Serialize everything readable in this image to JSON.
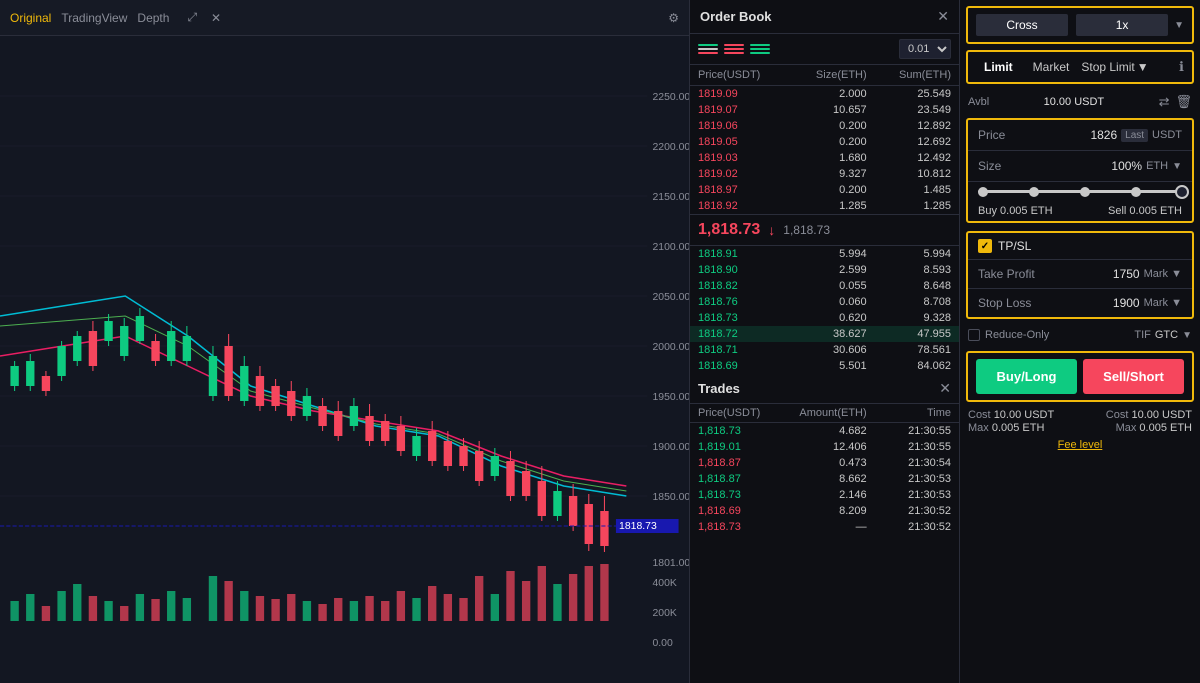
{
  "chart": {
    "tabs": [
      {
        "label": "Original",
        "active": true
      },
      {
        "label": "TradingView",
        "active": false
      },
      {
        "label": "Depth",
        "active": false
      }
    ],
    "price_levels": [
      "2250.00",
      "2200.00",
      "2150.00",
      "2100.00",
      "2050.00",
      "2000.00",
      "1950.00",
      "1900.00",
      "1850.00",
      "1801.00"
    ],
    "volume_labels": [
      "400K",
      "200K",
      "0.00"
    ],
    "current_price_tag": "1818.73"
  },
  "order_book": {
    "title": "Order Book",
    "size_option": "0.01",
    "col_headers": [
      "Price(USDT)",
      "Size(ETH)",
      "Sum(ETH)"
    ],
    "sell_orders": [
      {
        "price": "1819.09",
        "size": "2.000",
        "sum": "25.549"
      },
      {
        "price": "1819.07",
        "size": "10.657",
        "sum": "23.549"
      },
      {
        "price": "1819.06",
        "size": "0.200",
        "sum": "12.892"
      },
      {
        "price": "1819.05",
        "size": "0.200",
        "sum": "12.692"
      },
      {
        "price": "1819.03",
        "size": "1.680",
        "sum": "12.492"
      },
      {
        "price": "1819.02",
        "size": "9.327",
        "sum": "10.812"
      },
      {
        "price": "1818.97",
        "size": "0.200",
        "sum": "1.485"
      },
      {
        "price": "1818.92",
        "size": "1.285",
        "sum": "1.285"
      }
    ],
    "current_price": "1,818.73",
    "current_price_direction": "↓",
    "current_price_sub": "1,818.73",
    "buy_orders": [
      {
        "price": "1818.91",
        "size": "5.994",
        "sum": "5.994"
      },
      {
        "price": "1818.90",
        "size": "2.599",
        "sum": "8.593"
      },
      {
        "price": "1818.82",
        "size": "0.055",
        "sum": "8.648"
      },
      {
        "price": "1818.76",
        "size": "0.060",
        "sum": "8.708"
      },
      {
        "price": "1818.73",
        "size": "0.620",
        "sum": "9.328"
      },
      {
        "price": "1818.72",
        "size": "38.627",
        "sum": "47.955",
        "highlight": true
      },
      {
        "price": "1818.71",
        "size": "30.606",
        "sum": "78.561"
      },
      {
        "price": "1818.69",
        "size": "5.501",
        "sum": "84.062"
      }
    ]
  },
  "trades": {
    "title": "Trades",
    "col_headers": [
      "Price(USDT)",
      "Amount(ETH)",
      "Time"
    ],
    "rows": [
      {
        "price": "1,818.73",
        "color": "green",
        "amount": "4.682",
        "time": "21:30:55"
      },
      {
        "price": "1,819.01",
        "color": "green",
        "amount": "12.406",
        "time": "21:30:55"
      },
      {
        "price": "1,818.87",
        "color": "red",
        "amount": "0.473",
        "time": "21:30:54"
      },
      {
        "price": "1,818.87",
        "color": "green",
        "amount": "8.662",
        "time": "21:30:53"
      },
      {
        "price": "1,818.73",
        "color": "green",
        "amount": "2.146",
        "time": "21:30:53"
      },
      {
        "price": "1,818.69",
        "color": "red",
        "amount": "8.209",
        "time": "21:30:52"
      },
      {
        "price": "1,818.73",
        "color": "red",
        "amount": "—",
        "time": "21:30:52"
      }
    ]
  },
  "trading": {
    "leverage_btn": "Cross",
    "leverage_value": "1x",
    "order_types": [
      "Limit",
      "Market",
      "Stop Limit"
    ],
    "active_order_type": "Limit",
    "avbl_label": "Avbl",
    "avbl_value": "10.00 USDT",
    "price_label": "Price",
    "price_value": "1826",
    "price_badge": "Last",
    "price_unit": "USDT",
    "size_label": "Size",
    "size_value": "100%",
    "size_unit": "ETH",
    "buy_qty": "0.005 ETH",
    "sell_qty": "0.005 ETH",
    "tpsl_label": "TP/SL",
    "take_profit_label": "Take Profit",
    "take_profit_value": "1750",
    "take_profit_unit": "Mark",
    "stop_loss_label": "Stop Loss",
    "stop_loss_value": "1900",
    "stop_loss_unit": "Mark",
    "reduce_only_label": "Reduce-Only",
    "tif_label": "TIF",
    "tif_value": "GTC",
    "buy_btn": "Buy/Long",
    "sell_btn": "Sell/Short",
    "buy_cost_label": "Cost",
    "buy_cost_value": "10.00 USDT",
    "sell_cost_label": "Cost",
    "sell_cost_value": "10.00 USDT",
    "buy_max_label": "Max",
    "buy_max_value": "0.005 ETH",
    "sell_max_label": "Max",
    "sell_max_value": "0.005 ETH",
    "fee_level": "Fee level"
  }
}
